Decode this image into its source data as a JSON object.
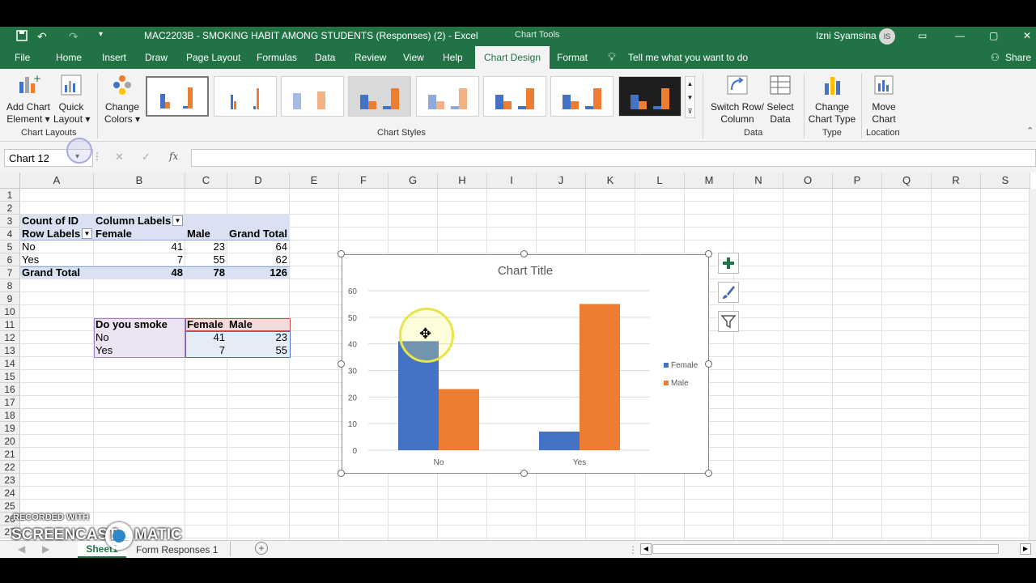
{
  "window": {
    "quick_access": [
      "save-icon",
      "undo-icon",
      "redo-icon",
      "customize-icon"
    ],
    "title": "MAC2203B - SMOKING HABIT AMONG STUDENTS (Responses) (2)  -  Excel",
    "context": "Chart Tools",
    "user": "Izni Syamsina",
    "user_initials": "IS"
  },
  "menu": {
    "file": "File",
    "home": "Home",
    "insert": "Insert",
    "draw": "Draw",
    "page_layout": "Page Layout",
    "formulas": "Formulas",
    "data": "Data",
    "review": "Review",
    "view": "View",
    "help": "Help",
    "chart_design": "Chart Design",
    "format": "Format",
    "tell_me": "Tell me what you want to do",
    "share": "Share"
  },
  "ribbon": {
    "add_chart_element": [
      "Add Chart",
      "Element"
    ],
    "quick_layout": [
      "Quick",
      "Layout"
    ],
    "change_colors": [
      "Change",
      "Colors"
    ],
    "chart_layouts_group": "Chart Layouts",
    "chart_styles_group": "Chart Styles",
    "switch_row_column": [
      "Switch Row/",
      "Column"
    ],
    "select_data": [
      "Select",
      "Data"
    ],
    "data_group": "Data",
    "change_chart_type": [
      "Change",
      "Chart Type"
    ],
    "type_group": "Type",
    "move_chart": [
      "Move",
      "Chart"
    ],
    "location_group": "Location"
  },
  "formula_bar": {
    "name_box": "Chart 12",
    "fx": "fx",
    "value": ""
  },
  "columns": [
    "A",
    "B",
    "C",
    "D",
    "E",
    "F",
    "G",
    "H",
    "I",
    "J",
    "K",
    "L",
    "M",
    "N",
    "O",
    "P",
    "Q",
    "R",
    "S"
  ],
  "rows": [
    "1",
    "2",
    "3",
    "4",
    "5",
    "6",
    "7",
    "8",
    "9",
    "10",
    "11",
    "12",
    "13",
    "14",
    "15",
    "16",
    "17",
    "18",
    "19",
    "20",
    "21",
    "22",
    "23",
    "24",
    "25",
    "26",
    "27"
  ],
  "pivot": {
    "count_label": "Count of ID",
    "column_labels": "Column Labels",
    "row_labels": "Row Labels",
    "col_female": "Female",
    "col_male": "Male",
    "col_grand_total": "Grand Total",
    "rows": [
      {
        "label": "No",
        "female": "41",
        "male": "23",
        "total": "64"
      },
      {
        "label": "Yes",
        "female": "7",
        "male": "55",
        "total": "62"
      }
    ],
    "grand_total": {
      "label": "Grand Total",
      "female": "48",
      "male": "78",
      "total": "126"
    }
  },
  "source_table": {
    "header": "Do you smoke",
    "col_female": "Female",
    "col_male": "Male",
    "rows": [
      {
        "label": "No",
        "female": "41",
        "male": "23"
      },
      {
        "label": "Yes",
        "female": "7",
        "male": "55"
      }
    ]
  },
  "chart_data": {
    "type": "bar",
    "title": "Chart Title",
    "categories": [
      "No",
      "Yes"
    ],
    "series": [
      {
        "name": "Female",
        "values": [
          41,
          7
        ],
        "color": "#4472c4"
      },
      {
        "name": "Male",
        "values": [
          23,
          55
        ],
        "color": "#ed7d31"
      }
    ],
    "ylim": [
      0,
      60
    ],
    "yticks": [
      "0",
      "10",
      "20",
      "30",
      "40",
      "50",
      "60"
    ],
    "grid": true,
    "legend": "right"
  },
  "sheet_tabs": {
    "active": "Sheet1",
    "other": "Form Responses 1",
    "add": "+"
  },
  "watermark": {
    "line1": "RECORDED WITH",
    "line2": "SCREENCAST",
    "line3": "MATIC"
  }
}
